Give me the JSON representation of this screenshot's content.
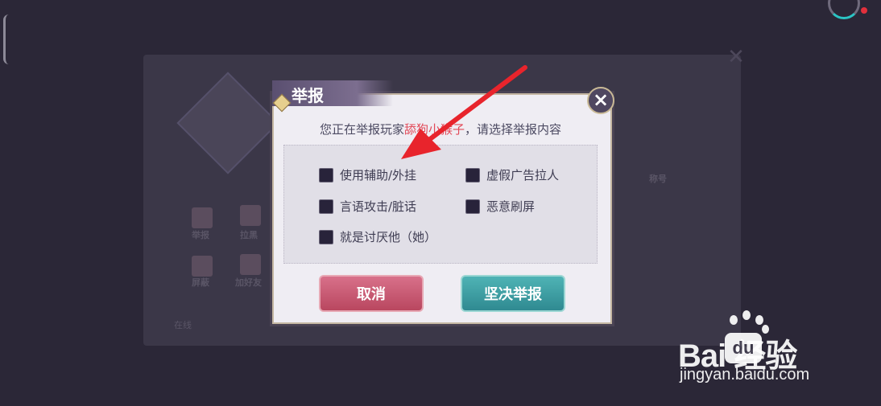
{
  "background": {
    "labels": [
      "举报",
      "拉黑",
      "屏蔽",
      "加好友",
      "称号",
      "在线"
    ]
  },
  "dialog": {
    "title": "举报",
    "close_glyph": "×",
    "prompt_prefix": "您正在举报玩家",
    "player_name": "舔狗小猴子",
    "prompt_suffix": "，请选择举报内容",
    "options": [
      {
        "label": "使用辅助/外挂",
        "checked": false
      },
      {
        "label": "虚假广告拉人",
        "checked": false
      },
      {
        "label": "言语攻击/脏话",
        "checked": false
      },
      {
        "label": "恶意刷屏",
        "checked": false
      },
      {
        "label": "就是讨厌他（她）",
        "checked": false
      }
    ],
    "cancel_label": "取消",
    "confirm_label": "坚决举报"
  },
  "watermark": {
    "brand": "Bai   经验",
    "brand_du": "du",
    "url": "jingyan.baidu.com"
  },
  "colors": {
    "accent_red": "#e24a59",
    "cancel": "#c85a73",
    "confirm": "#3c9ea2",
    "arrow": "#e8242c"
  }
}
